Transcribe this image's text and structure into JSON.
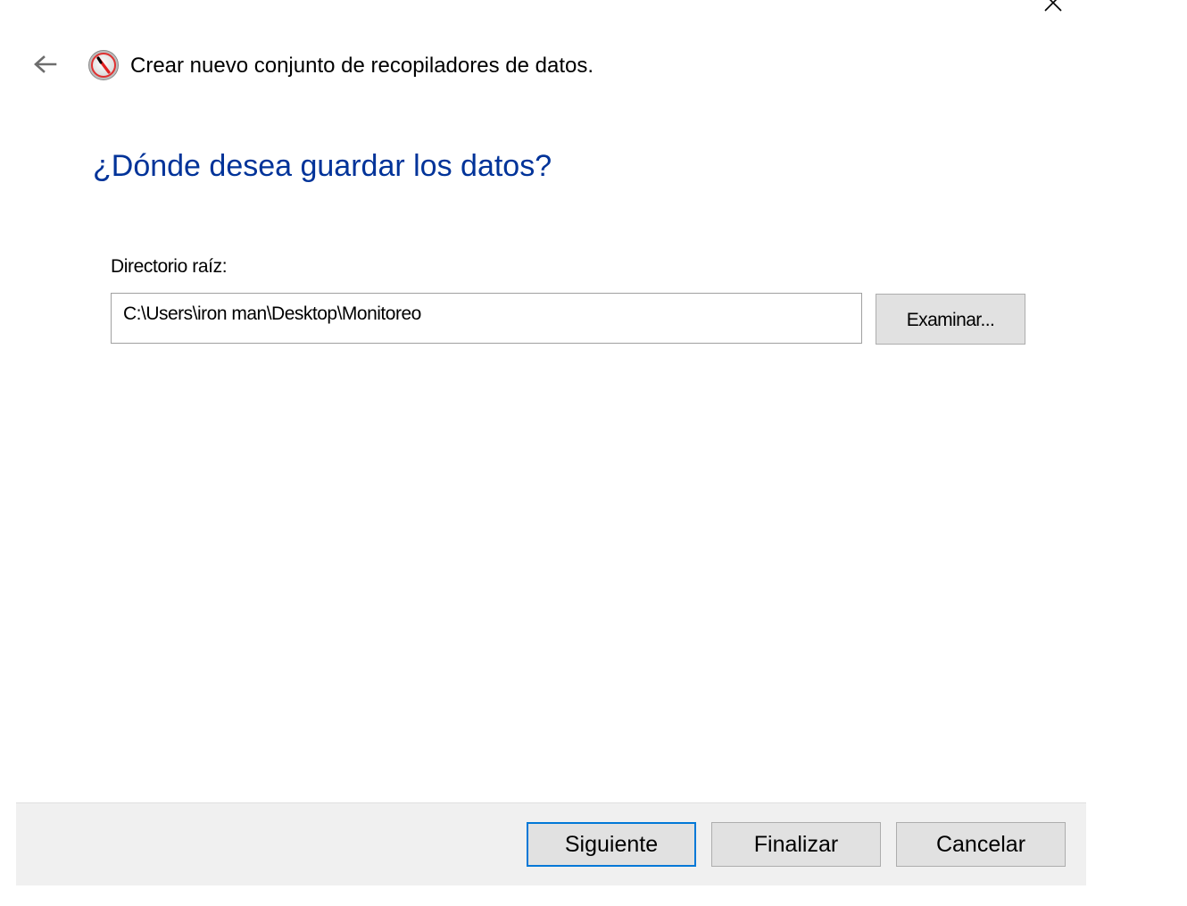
{
  "window": {
    "close_glyph": "✕",
    "back_glyph": "←",
    "app_icon": "performance-monitor-icon",
    "title": "Crear nuevo conjunto de recopiladores de datos."
  },
  "page": {
    "heading": "¿Dónde desea guardar los datos?",
    "root_dir_label": "Directorio raíz:",
    "root_dir_value": "C:\\Users\\iron man\\Desktop\\Monitoreo",
    "browse_label": "Examinar..."
  },
  "footer": {
    "next_label": "Siguiente",
    "finish_label": "Finalizar",
    "cancel_label": "Cancelar"
  },
  "colors": {
    "heading": "#003399",
    "footer_bg": "#f0f0f0",
    "button_bg": "#e1e1e1",
    "default_button_border": "#0078d7",
    "icon_red": "#e02020"
  }
}
